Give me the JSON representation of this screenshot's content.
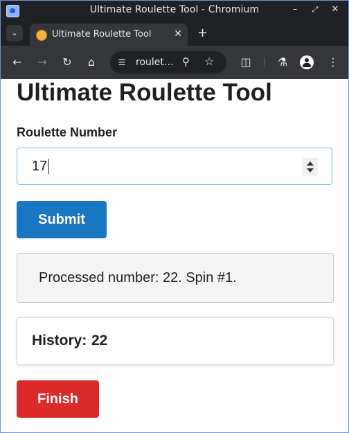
{
  "window": {
    "title": "Ultimate Roulette Tool - Chromium"
  },
  "tabs": [
    {
      "label": "Ultimate Roulette Tool",
      "active": true
    }
  ],
  "toolbar": {
    "url_display": "roulet…"
  },
  "page": {
    "heading": "Ultimate Roulette Tool",
    "number_label": "Roulette Number",
    "number_value": "17",
    "submit_label": "Submit",
    "result_text": "Processed number: 22. Spin #1.",
    "history_label": "History:",
    "history_value": "22",
    "finish_label": "Finish"
  },
  "colors": {
    "submit": "#1a78c2",
    "finish": "#dc2a2a",
    "browser_frame": "#202124",
    "toolbar": "#35363a"
  },
  "icons": {
    "titlebar": [
      "minimize-icon",
      "restore-icon",
      "close-icon"
    ],
    "toolbar": [
      "back-icon",
      "forward-icon",
      "reload-icon",
      "home-icon",
      "site-info-icon",
      "zoom-icon",
      "star-icon",
      "extensions-icon",
      "labs-icon",
      "profile-icon",
      "menu-icon"
    ]
  }
}
